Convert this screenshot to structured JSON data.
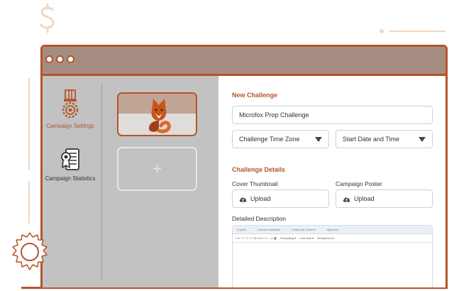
{
  "sidebar": {
    "items": [
      {
        "label": "Campaign Settings",
        "icon": "medal-gear-icon",
        "active": true
      },
      {
        "label": "Campaign Statistics",
        "icon": "certificate-icon",
        "active": false
      }
    ],
    "add_symbol": "+"
  },
  "form": {
    "new_challenge_heading": "New Challenge",
    "challenge_name": "Microfox Prop Challenge",
    "timezone_label": "Challenge Time Zone",
    "start_date_label": "Start Date and Time",
    "details_heading": "Challenge Details",
    "cover_label": "Cover Thumbnail",
    "poster_label": "Campaign Poster",
    "upload_label": "Upload",
    "description_label": "Detailed Description",
    "language_tabs": [
      "English",
      "Chinese Simplified",
      "Traditional Chinese",
      "Japanese"
    ],
    "toolbar_format": "Formatting",
    "toolbar_font": "Font Size",
    "toolbar_default": "Default font"
  },
  "colors": {
    "accent": "#b5542a",
    "titlebar": "#a58e81",
    "sidebar_bg": "#c2c2c2"
  }
}
